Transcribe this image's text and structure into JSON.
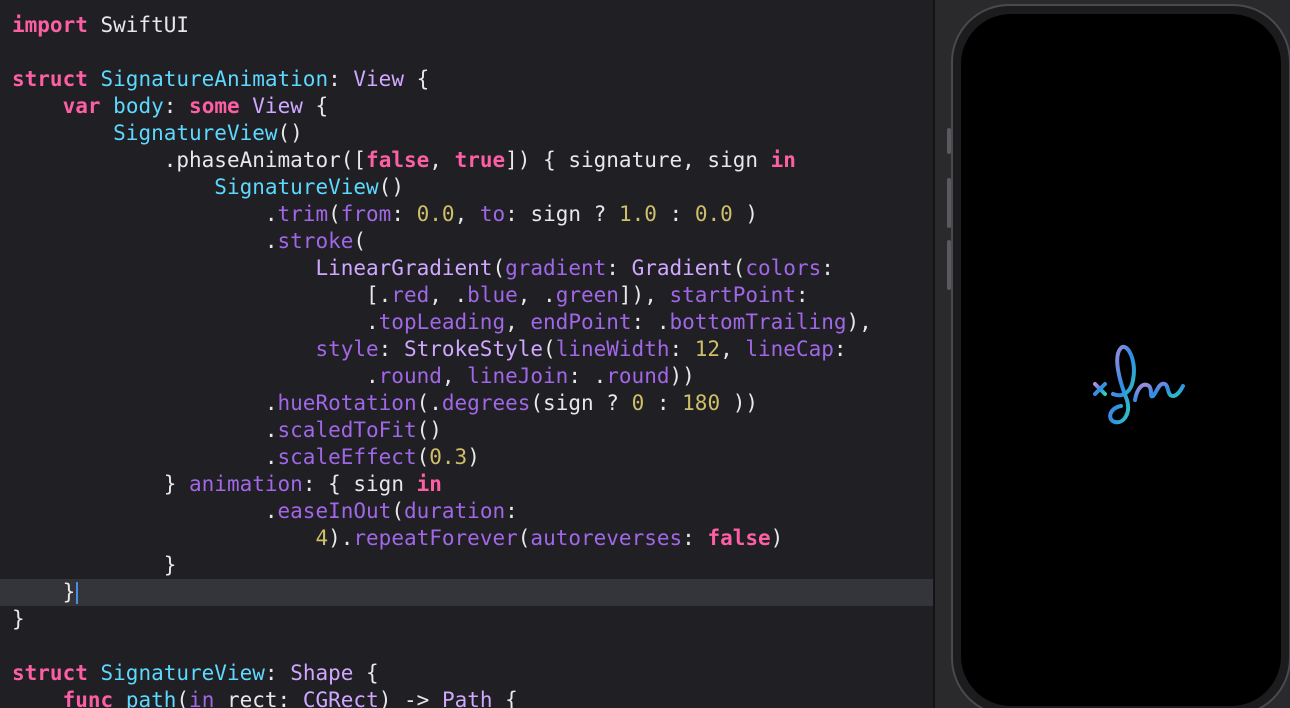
{
  "editor": {
    "active_line": 21,
    "lines": [
      [
        [
          "kw",
          "import"
        ],
        [
          "plain",
          " SwiftUI"
        ]
      ],
      [],
      [
        [
          "kw",
          "struct"
        ],
        [
          "plain",
          " "
        ],
        [
          "decl",
          "SignatureAnimation"
        ],
        [
          "plain",
          ": "
        ],
        [
          "type",
          "View"
        ],
        [
          "plain",
          " {"
        ]
      ],
      [
        [
          "plain",
          "    "
        ],
        [
          "kw",
          "var"
        ],
        [
          "plain",
          " "
        ],
        [
          "decl",
          "body"
        ],
        [
          "plain",
          ": "
        ],
        [
          "kw",
          "some"
        ],
        [
          "plain",
          " "
        ],
        [
          "type",
          "View"
        ],
        [
          "plain",
          " {"
        ]
      ],
      [
        [
          "plain",
          "        "
        ],
        [
          "decl",
          "SignatureView"
        ],
        [
          "plain",
          "()"
        ]
      ],
      [
        [
          "plain",
          "            ."
        ],
        [
          "plain",
          "phaseAnimator"
        ],
        [
          "plain",
          "(["
        ],
        [
          "kw",
          "false"
        ],
        [
          "plain",
          ", "
        ],
        [
          "kw",
          "true"
        ],
        [
          "plain",
          "]) { signature, sign "
        ],
        [
          "kw",
          "in"
        ]
      ],
      [
        [
          "plain",
          "                "
        ],
        [
          "decl",
          "SignatureView"
        ],
        [
          "plain",
          "()"
        ]
      ],
      [
        [
          "plain",
          "                    ."
        ],
        [
          "prop",
          "trim"
        ],
        [
          "plain",
          "("
        ],
        [
          "prop",
          "from"
        ],
        [
          "plain",
          ": "
        ],
        [
          "num",
          "0.0"
        ],
        [
          "plain",
          ", "
        ],
        [
          "prop",
          "to"
        ],
        [
          "plain",
          ": sign ? "
        ],
        [
          "num",
          "1.0"
        ],
        [
          "plain",
          " : "
        ],
        [
          "num",
          "0.0"
        ],
        [
          "plain",
          " )"
        ]
      ],
      [
        [
          "plain",
          "                    ."
        ],
        [
          "prop",
          "stroke"
        ],
        [
          "plain",
          "("
        ]
      ],
      [
        [
          "plain",
          "                        "
        ],
        [
          "type",
          "LinearGradient"
        ],
        [
          "plain",
          "("
        ],
        [
          "prop",
          "gradient"
        ],
        [
          "plain",
          ": "
        ],
        [
          "type",
          "Gradient"
        ],
        [
          "plain",
          "("
        ],
        [
          "prop",
          "colors"
        ],
        [
          "plain",
          ":"
        ]
      ],
      [
        [
          "plain",
          "                            [."
        ],
        [
          "prop",
          "red"
        ],
        [
          "plain",
          ", ."
        ],
        [
          "prop",
          "blue"
        ],
        [
          "plain",
          ", ."
        ],
        [
          "prop",
          "green"
        ],
        [
          "plain",
          "]), "
        ],
        [
          "prop",
          "startPoint"
        ],
        [
          "plain",
          ":"
        ]
      ],
      [
        [
          "plain",
          "                            ."
        ],
        [
          "prop",
          "topLeading"
        ],
        [
          "plain",
          ", "
        ],
        [
          "prop",
          "endPoint"
        ],
        [
          "plain",
          ": ."
        ],
        [
          "prop",
          "bottomTrailing"
        ],
        [
          "plain",
          "),"
        ]
      ],
      [
        [
          "plain",
          "                        "
        ],
        [
          "prop",
          "style"
        ],
        [
          "plain",
          ": "
        ],
        [
          "type",
          "StrokeStyle"
        ],
        [
          "plain",
          "("
        ],
        [
          "prop",
          "lineWidth"
        ],
        [
          "plain",
          ": "
        ],
        [
          "num",
          "12"
        ],
        [
          "plain",
          ", "
        ],
        [
          "prop",
          "lineCap"
        ],
        [
          "plain",
          ":"
        ]
      ],
      [
        [
          "plain",
          "                            ."
        ],
        [
          "prop",
          "round"
        ],
        [
          "plain",
          ", "
        ],
        [
          "prop",
          "lineJoin"
        ],
        [
          "plain",
          ": ."
        ],
        [
          "prop",
          "round"
        ],
        [
          "plain",
          "))"
        ]
      ],
      [
        [
          "plain",
          "                    ."
        ],
        [
          "prop",
          "hueRotation"
        ],
        [
          "plain",
          "(."
        ],
        [
          "prop",
          "degrees"
        ],
        [
          "plain",
          "(sign ? "
        ],
        [
          "num",
          "0"
        ],
        [
          "plain",
          " : "
        ],
        [
          "num",
          "180"
        ],
        [
          "plain",
          " ))"
        ]
      ],
      [
        [
          "plain",
          "                    ."
        ],
        [
          "prop",
          "scaledToFit"
        ],
        [
          "plain",
          "()"
        ]
      ],
      [
        [
          "plain",
          "                    ."
        ],
        [
          "prop",
          "scaleEffect"
        ],
        [
          "plain",
          "("
        ],
        [
          "num",
          "0.3"
        ],
        [
          "plain",
          ")"
        ]
      ],
      [
        [
          "plain",
          "            } "
        ],
        [
          "prop",
          "animation"
        ],
        [
          "plain",
          ": { sign "
        ],
        [
          "kw",
          "in"
        ]
      ],
      [
        [
          "plain",
          "                    ."
        ],
        [
          "prop",
          "easeInOut"
        ],
        [
          "plain",
          "("
        ],
        [
          "prop",
          "duration"
        ],
        [
          "plain",
          ":"
        ]
      ],
      [
        [
          "plain",
          "                        "
        ],
        [
          "num",
          "4"
        ],
        [
          "plain",
          ")."
        ],
        [
          "prop",
          "repeatForever"
        ],
        [
          "plain",
          "("
        ],
        [
          "prop",
          "autoreverses"
        ],
        [
          "plain",
          ": "
        ],
        [
          "kw",
          "false"
        ],
        [
          "plain",
          ")"
        ]
      ],
      [
        [
          "plain",
          "            }"
        ]
      ],
      [
        [
          "plain",
          "    }"
        ]
      ],
      [
        [
          "plain",
          "}"
        ]
      ],
      [],
      [
        [
          "kw",
          "struct"
        ],
        [
          "plain",
          " "
        ],
        [
          "decl",
          "SignatureView"
        ],
        [
          "plain",
          ": "
        ],
        [
          "type",
          "Shape"
        ],
        [
          "plain",
          " {"
        ]
      ],
      [
        [
          "plain",
          "    "
        ],
        [
          "kw",
          "func"
        ],
        [
          "plain",
          " "
        ],
        [
          "decl",
          "path"
        ],
        [
          "plain",
          "("
        ],
        [
          "prop",
          "in"
        ],
        [
          "plain",
          " rect: "
        ],
        [
          "type",
          "CGRect"
        ],
        [
          "plain",
          ") -> "
        ],
        [
          "type",
          "Path"
        ],
        [
          "plain",
          " {"
        ]
      ]
    ]
  },
  "preview": {
    "screen_color": "#000000",
    "signature_icon": "signature-icon",
    "gradient_colors": [
      "#c18ad8",
      "#2f8ce6",
      "#2fd7b3"
    ]
  }
}
